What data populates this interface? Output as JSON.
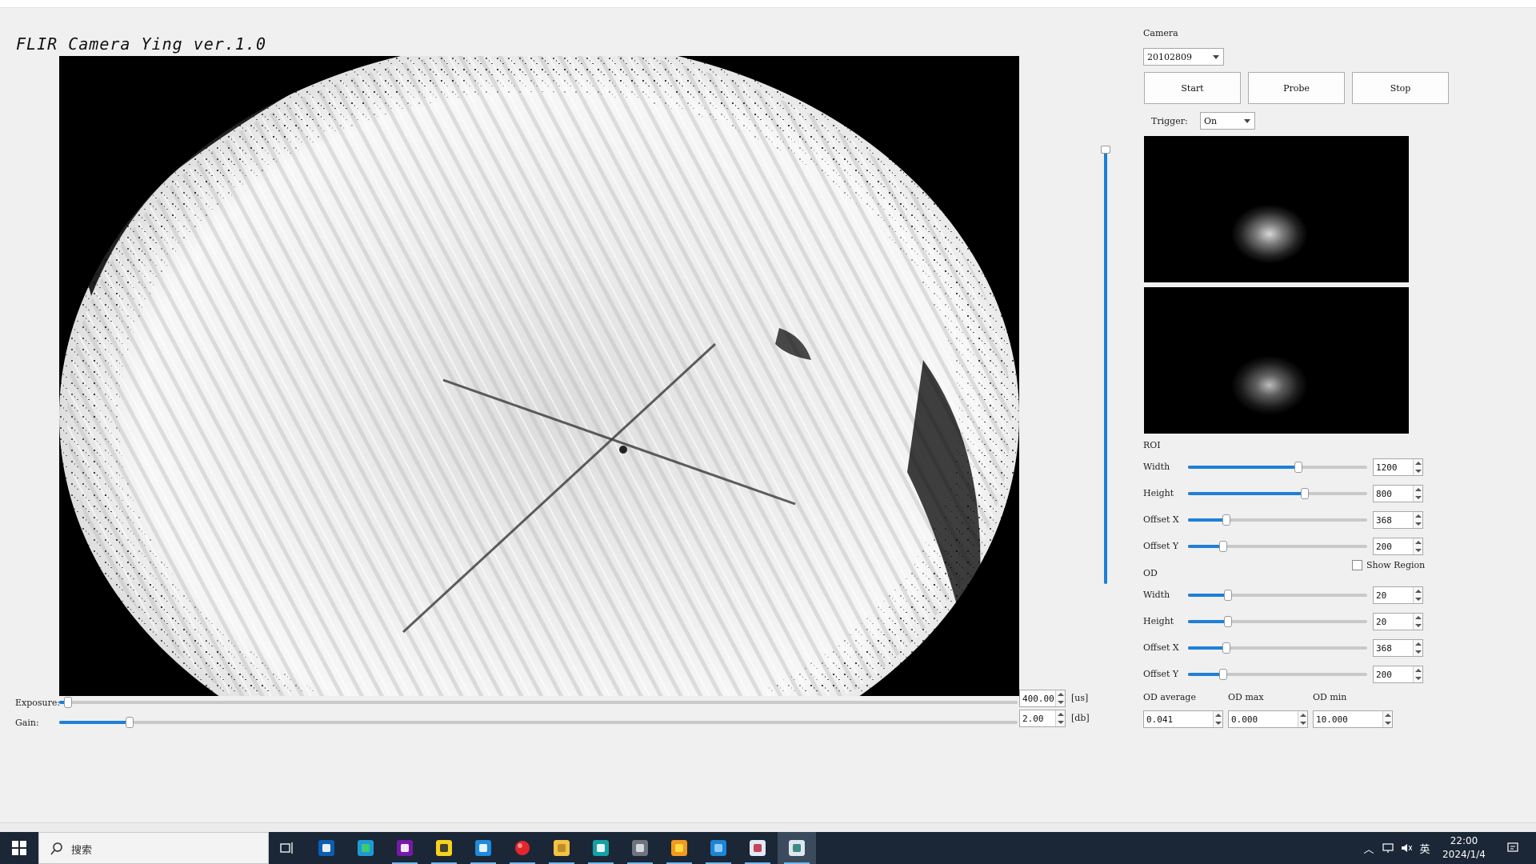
{
  "app": {
    "title": "FLIR Camera Ying ver.1.0"
  },
  "controls": {
    "exposure": {
      "label": "Exposure:",
      "value": "400.00",
      "unit": "[us]",
      "level": 0.005
    },
    "gain": {
      "label": "Gain:",
      "value": "2.00",
      "unit": "[db]",
      "level": 0.07
    },
    "image_scale_level": 1.0
  },
  "camera": {
    "label": "Camera",
    "selected": "20102809",
    "start_label": "Start",
    "probe_label": "Probe",
    "stop_label": "Stop",
    "trigger_label": "Trigger:",
    "trigger_value": "On"
  },
  "roi": {
    "heading": "ROI",
    "rows": [
      {
        "label": "Width",
        "value": "1200",
        "level": 0.62
      },
      {
        "label": "Height",
        "value": "800",
        "level": 0.66
      },
      {
        "label": "Offset X",
        "value": "368",
        "level": 0.2
      },
      {
        "label": "Offset Y",
        "value": "200",
        "level": 0.18
      }
    ]
  },
  "od": {
    "heading": "OD",
    "show_region_label": "Show Region",
    "show_region_checked": false,
    "rows": [
      {
        "label": "Width",
        "value": "20",
        "level": 0.21
      },
      {
        "label": "Height",
        "value": "20",
        "level": 0.21
      },
      {
        "label": "Offset X",
        "value": "368",
        "level": 0.2
      },
      {
        "label": "Offset Y",
        "value": "200",
        "level": 0.18
      }
    ],
    "average_label": "OD average",
    "max_label": "OD max",
    "min_label": "OD min",
    "average_value": "0.041",
    "max_value": "0.000",
    "min_value": "10.000"
  },
  "taskbar": {
    "search_placeholder": "搜索",
    "ime": "英",
    "time": "22:00",
    "date": "2024/1/4",
    "icons": [
      "task-view-icon",
      "outlook-icon",
      "edge-icon",
      "onenote-icon",
      "sticky-notes-icon",
      "vscode-icon",
      "red-dot-app-icon",
      "file-explorer-icon",
      "arduino-icon",
      "virtual-machine-icon",
      "emoji-app-icon",
      "paint-icon",
      "security-app-icon",
      "flir-app-icon"
    ]
  },
  "colors": {
    "accent": "#1e7fd8",
    "taskbar": "#1b2736"
  }
}
